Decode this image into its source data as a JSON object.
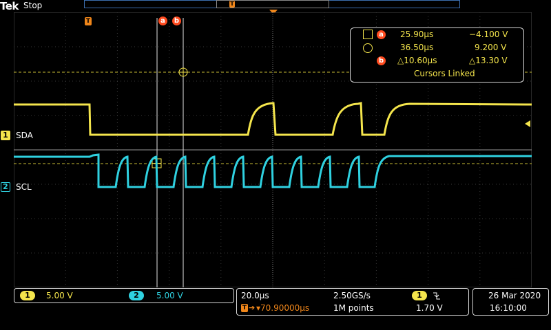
{
  "header": {
    "brand": "Tek",
    "status": "Stop"
  },
  "markers": {
    "trigger": "T",
    "cursor_a": "a",
    "cursor_b": "b"
  },
  "channels": [
    {
      "number": "1",
      "name": "SDA",
      "color": "#f4e54c"
    },
    {
      "number": "2",
      "name": "SCL",
      "color": "#2fd1e0"
    }
  ],
  "readout": {
    "row1": {
      "badge": "a",
      "time": "25.90µs",
      "value": "−4.100 V"
    },
    "row2": {
      "time": "36.50µs",
      "value": "9.200 V"
    },
    "row3": {
      "badge": "b",
      "time": "△10.60µs",
      "value": "△13.30 V"
    },
    "linked": "Cursors Linked"
  },
  "scale": {
    "ch1_tag": "1",
    "ch1": "5.00 V",
    "ch2_tag": "2",
    "ch2": "5.00 V"
  },
  "timebase": {
    "time_div": "20.0µs",
    "sample_rate": "2.50GS/s",
    "trigger_position": "▾70.90000µs",
    "record_length": "1M points",
    "trigger_source": "1",
    "trigger_slope_icon": "falling-edge-icon",
    "trigger_level": "1.70 V"
  },
  "datetime": {
    "date": "26 Mar  2020",
    "time": "16:10:00"
  }
}
